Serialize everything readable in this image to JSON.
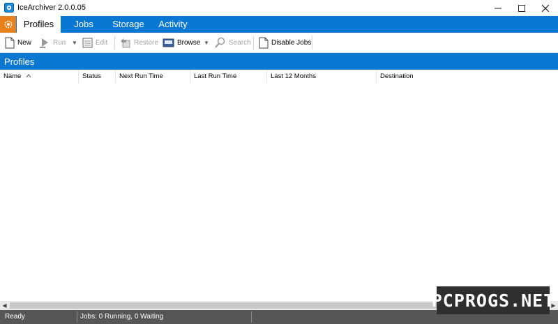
{
  "window": {
    "title": "IceArchiver 2.0.0.05"
  },
  "tabs": [
    {
      "label": "Profiles",
      "active": true
    },
    {
      "label": "Jobs",
      "active": false
    },
    {
      "label": "Storage",
      "active": false
    },
    {
      "label": "Activity",
      "active": false
    }
  ],
  "toolbar": {
    "new_label": "New",
    "run_label": "Run",
    "edit_label": "Edit",
    "restore_label": "Restore",
    "browse_label": "Browse",
    "search_label": "Search",
    "disable_jobs_label": "Disable Jobs"
  },
  "section": {
    "title": "Profiles"
  },
  "columns": [
    "Name",
    "Status",
    "Next Run Time",
    "Last Run Time",
    "Last 12 Months",
    "Destination"
  ],
  "status": {
    "ready": "Ready",
    "jobs": "Jobs: 0 Running, 0 Waiting"
  },
  "watermark": "PCPROGS.NET",
  "colors": {
    "accent": "#0a78d2",
    "app_menu": "#e8811b",
    "statusbar": "#565656"
  }
}
